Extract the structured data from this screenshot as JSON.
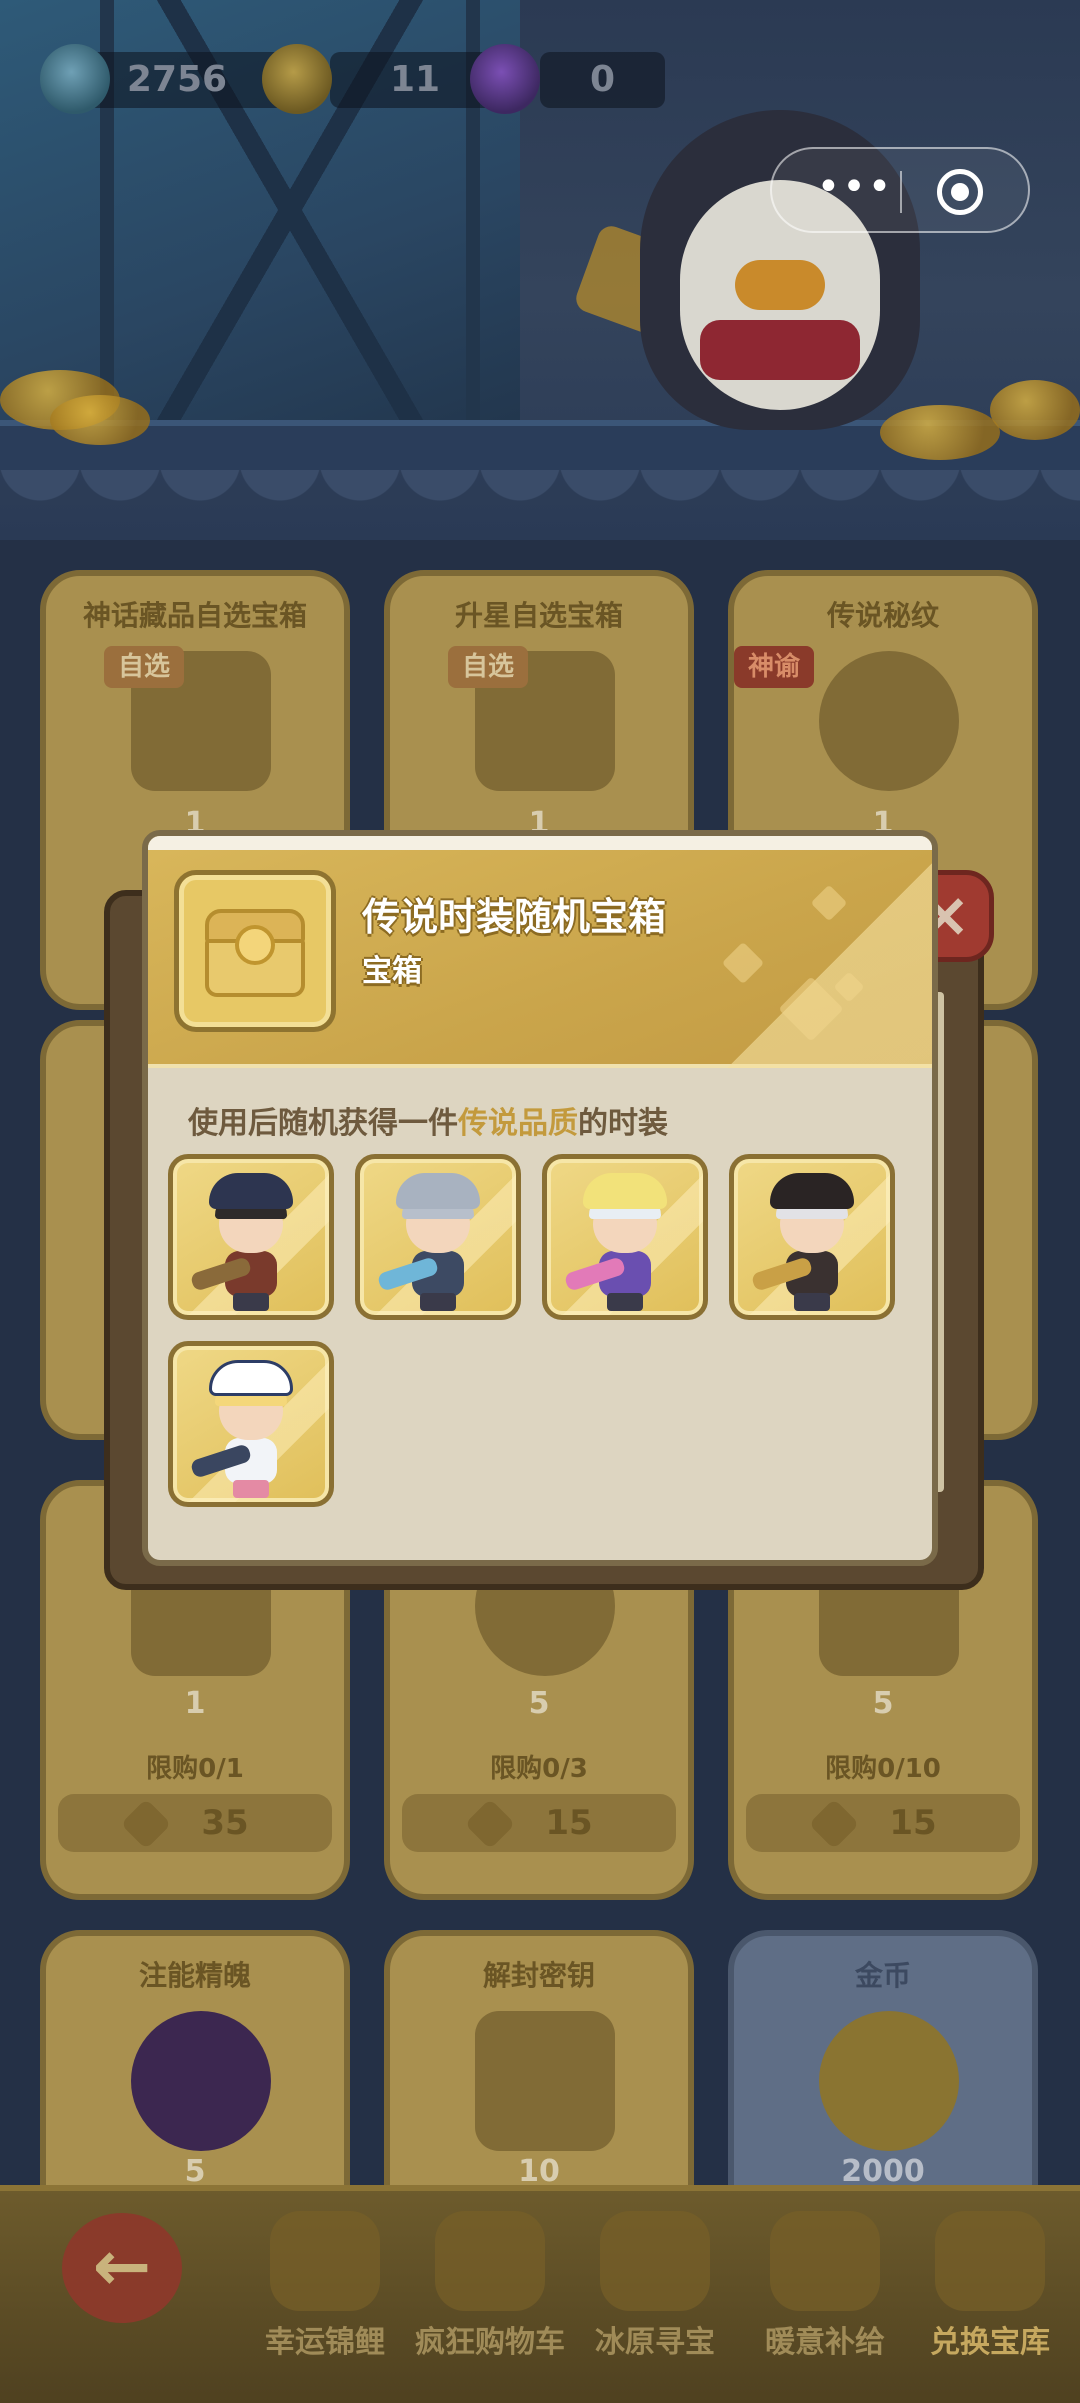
{
  "currency": {
    "gem": "2756",
    "crown": "11",
    "amethyst": "0"
  },
  "capsule": {
    "more_icon": "more-dots-icon",
    "close_icon": "target-circle-icon"
  },
  "shop": {
    "cards": [
      {
        "title": "神话藏品自选宝箱",
        "tag": "自选",
        "qty": "1"
      },
      {
        "title": "升星自选宝箱",
        "tag": "自选",
        "qty": "1"
      },
      {
        "title": "传说秘纹",
        "tag": "神谕",
        "qty": "1"
      },
      {
        "title": "",
        "qty": "1",
        "limit": "限购0/1",
        "price": "35"
      },
      {
        "title": "",
        "qty": "5",
        "limit": "限购0/3",
        "price": "15"
      },
      {
        "title": "",
        "qty": "5",
        "limit": "限购0/10",
        "price": "15"
      },
      {
        "title": "注能精魄",
        "qty": "5"
      },
      {
        "title": "解封密钥",
        "qty": "10"
      },
      {
        "title": "金币",
        "qty": "2000"
      }
    ]
  },
  "bottom_nav": {
    "back_label": "←",
    "items": [
      {
        "label": "幸运锦鲤"
      },
      {
        "label": "疯狂购物车"
      },
      {
        "label": "冰原寻宝"
      },
      {
        "label": "暖意补给"
      },
      {
        "label": "兑换宝库"
      }
    ]
  },
  "popup": {
    "close_label": "×",
    "item_title": "传说时装随机宝箱",
    "item_type": "宝箱",
    "desc_prefix": "使用后随机获得一件",
    "desc_highlight": "传说品质",
    "desc_suffix": "的时装",
    "costumes": [
      {
        "name": "pirate-costume"
      },
      {
        "name": "wolf-costume"
      },
      {
        "name": "goggles-costume"
      },
      {
        "name": "top-hat-costume"
      },
      {
        "name": "sailor-costume"
      }
    ]
  },
  "colors": {
    "gold": "#d9b75b",
    "highlight": "#c39a3d",
    "close_red": "#a03a30"
  }
}
